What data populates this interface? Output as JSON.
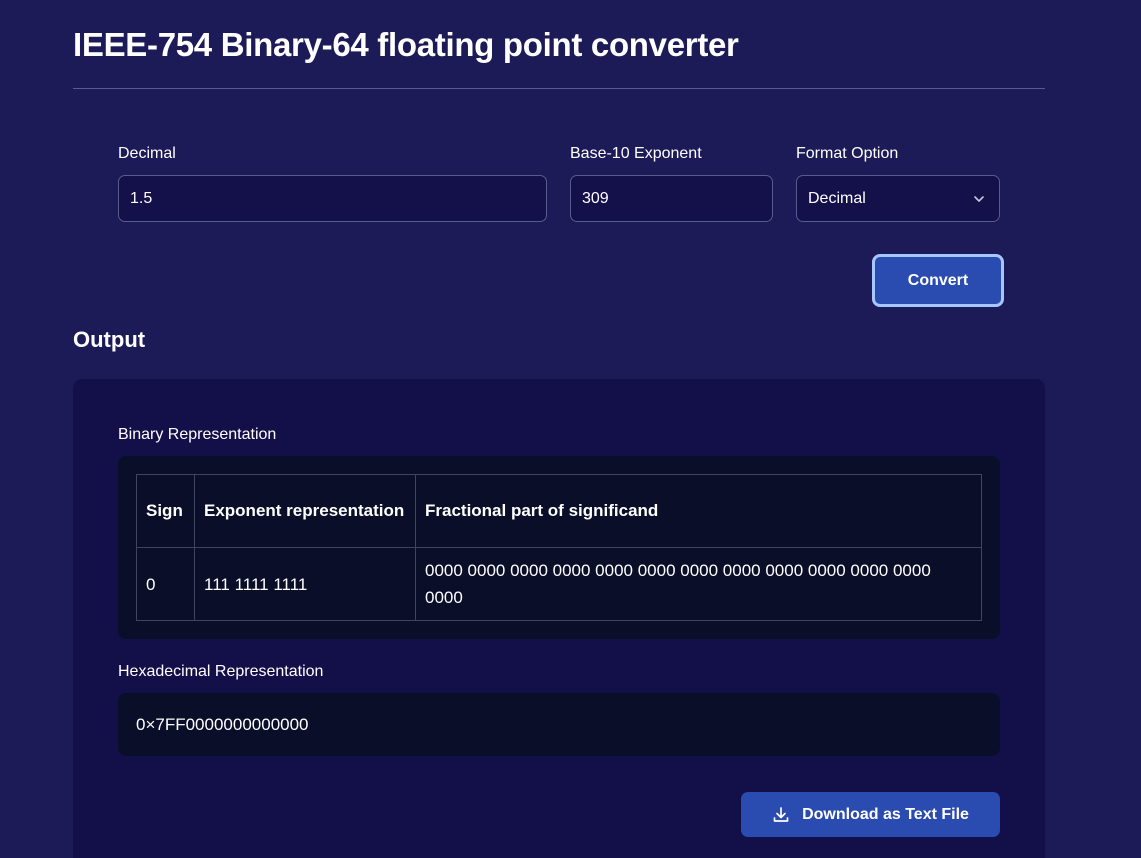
{
  "page": {
    "title": "IEEE-754 Binary-64 floating point converter"
  },
  "form": {
    "decimal_label": "Decimal",
    "decimal_value": "1.5",
    "exponent_label": "Base-10 Exponent",
    "exponent_value": "309",
    "format_label": "Format Option",
    "format_value": "Decimal",
    "convert_label": "Convert"
  },
  "output": {
    "heading": "Output",
    "binary_label": "Binary Representation",
    "table": {
      "headers": [
        "Sign",
        "Exponent representation",
        "Fractional part of significand"
      ],
      "row": {
        "sign": "0",
        "exponent": "111 1111 1111",
        "fraction": "0000 0000 0000 0000 0000 0000 0000 0000 0000 0000 0000 0000 0000"
      }
    },
    "hex_label": "Hexadecimal Representation",
    "hex_value": "0×7FF0000000000000",
    "download_label": "Download as Text File"
  },
  "icons": {
    "select": "chevron-down-icon",
    "download": "download-icon"
  },
  "colors": {
    "background": "#1c1a57",
    "panel": "#131049",
    "code_box": "#0a0e29",
    "button": "#2a4bb0",
    "button_focus_ring": "#a6c6ff"
  }
}
